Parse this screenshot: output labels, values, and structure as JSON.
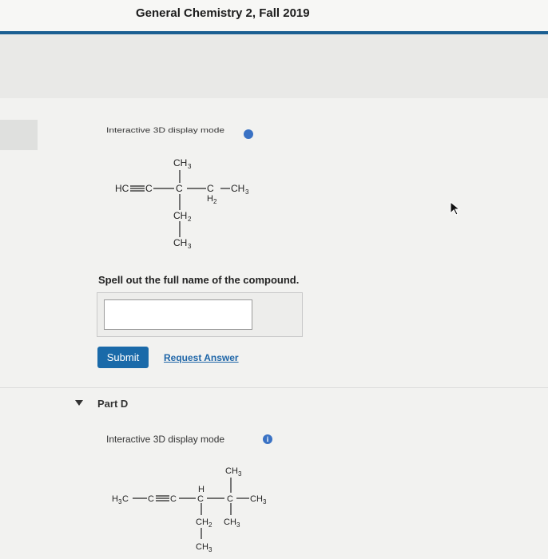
{
  "header": {
    "title": "General Chemistry 2, Fall 2019"
  },
  "part_c": {
    "display_mode_label": "Interactive 3D display mode",
    "info_icon": "info-icon",
    "structure": {
      "hc": "HC",
      "c1": "C",
      "c2": "C",
      "c3": "C",
      "h2_sub": "H",
      "h2_num": "2",
      "ch3_right": "CH",
      "ch3_right_num": "3",
      "ch3_top": "CH",
      "ch3_top_num": "3",
      "ch2_down": "CH",
      "ch2_down_num": "2",
      "ch3_bottom": "CH",
      "ch3_bottom_num": "3"
    },
    "question": "Spell out the full name of the compound.",
    "answer_value": "",
    "submit_label": "Submit",
    "request_label": "Request Answer"
  },
  "part_d": {
    "label": "Part D",
    "display_mode_label": "Interactive 3D display mode",
    "info_icon": "info-icon",
    "info_glyph": "i",
    "structure": {
      "h3c": "H",
      "h3c_num": "3",
      "h3c_c": "C",
      "c2": "C",
      "c3": "C",
      "c4": "C",
      "c5": "C",
      "h_top": "H",
      "ch3_top": "CH",
      "ch3_top_num": "3",
      "ch3_right": "CH",
      "ch3_right_num": "3",
      "ch2_down": "CH",
      "ch2_down_num": "2",
      "ch3_down": "CH",
      "ch3_down_num": "3",
      "ch3_bottom": "CH",
      "ch3_bottom_num": "3"
    }
  },
  "colors": {
    "accent": "#1b5f92",
    "button": "#1a6aa9",
    "link": "#1f66a8",
    "info": "#3a72c4"
  }
}
